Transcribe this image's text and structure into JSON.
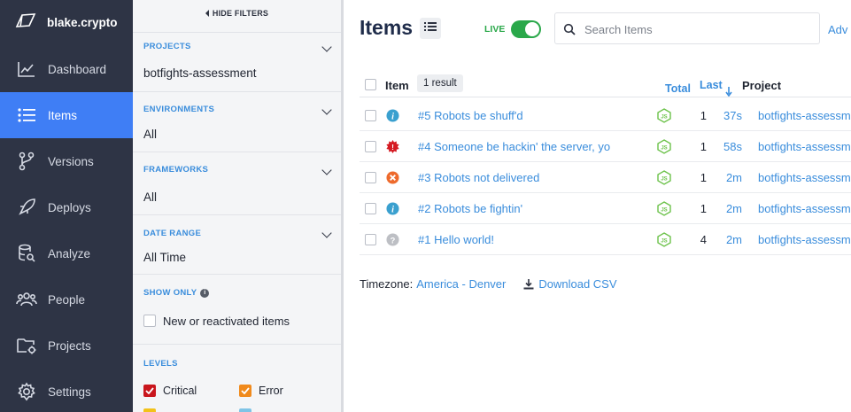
{
  "brand": {
    "name": "blake.crypto",
    "icon": "cube-logo-icon"
  },
  "nav": [
    {
      "label": "Dashboard",
      "icon": "chart-line-icon"
    },
    {
      "label": "Items",
      "icon": "list-icon",
      "active": true
    },
    {
      "label": "Versions",
      "icon": "git-branch-icon"
    },
    {
      "label": "Deploys",
      "icon": "rocket-icon"
    },
    {
      "label": "Analyze",
      "icon": "database-search-icon"
    },
    {
      "label": "People",
      "icon": "people-icon"
    },
    {
      "label": "Projects",
      "icon": "folder-gear-icon"
    },
    {
      "label": "Settings",
      "icon": "gear-icon"
    }
  ],
  "filters": {
    "hide_label": "HIDE FILTERS",
    "projects": {
      "title": "PROJECTS",
      "value": "botfights-assessment"
    },
    "environments": {
      "title": "ENVIRONMENTS",
      "value": "All"
    },
    "frameworks": {
      "title": "FRAMEWORKS",
      "value": "All"
    },
    "date_range": {
      "title": "DATE RANGE",
      "value": "All Time"
    },
    "show_only": {
      "title": "SHOW ONLY",
      "info": "i",
      "option": "New or reactivated items"
    },
    "levels": {
      "title": "LEVELS",
      "items": [
        {
          "label": "Critical",
          "color": "#c9161d",
          "checked": true
        },
        {
          "label": "Error",
          "color": "#f08a1c",
          "checked": true
        }
      ]
    }
  },
  "main": {
    "title": "Items",
    "live_label": "LIVE",
    "live_on": true,
    "search_placeholder": "Search Items",
    "advanced_label": "Adv",
    "columns": {
      "item": "Item",
      "total": "Total",
      "last": "Last",
      "project": "Project"
    },
    "result_badge": "1 result",
    "rows": [
      {
        "level": "info",
        "title": "#5 Robots be shuff'd",
        "framework": "nodejs-icon",
        "total": "1",
        "last": "37s",
        "project": "botfights-assessment"
      },
      {
        "level": "critical",
        "title": "#4 Someone be hackin' the server, yo",
        "framework": "nodejs-icon",
        "total": "1",
        "last": "58s",
        "project": "botfights-assessment"
      },
      {
        "level": "error",
        "title": "#3 Robots not delivered",
        "framework": "nodejs-icon",
        "total": "1",
        "last": "2m",
        "project": "botfights-assessment"
      },
      {
        "level": "info",
        "title": "#2 Robots be fightin'",
        "framework": "nodejs-icon",
        "total": "1",
        "last": "2m",
        "project": "botfights-assessment"
      },
      {
        "level": "unknown",
        "title": "#1 Hello world!",
        "framework": "nodejs-icon",
        "total": "4",
        "last": "2m",
        "project": "botfights-assessment"
      }
    ],
    "footer": {
      "tz_label": "Timezone:",
      "tz_value": "America - Denver",
      "csv_label": "Download CSV"
    }
  },
  "colors": {
    "nav_bg": "#2e3445",
    "nav_active": "#3f7ef5",
    "link": "#3a8ddc",
    "live": "#2aa84a"
  }
}
